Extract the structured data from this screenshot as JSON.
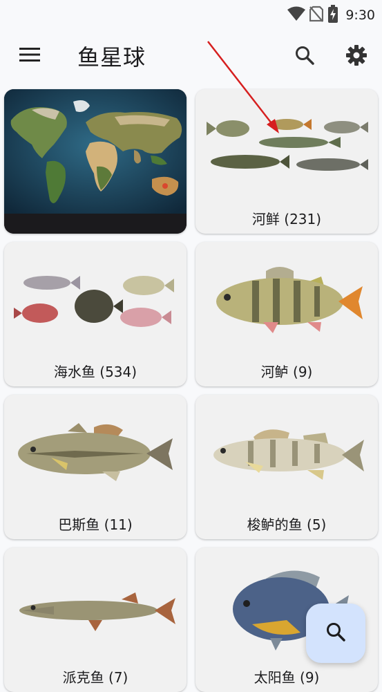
{
  "status_bar": {
    "time": "9:30"
  },
  "app_bar": {
    "title": "鱼星球"
  },
  "categories": [
    {
      "label": ""
    },
    {
      "label": "河鲜 (231)"
    },
    {
      "label": "海水鱼 (534)"
    },
    {
      "label": "河鲈 (9)"
    },
    {
      "label": "巴斯鱼 (11)"
    },
    {
      "label": "梭鲈的鱼 (5)"
    },
    {
      "label": "派克鱼 (7)"
    },
    {
      "label": "太阳鱼 (9)"
    }
  ],
  "colors": {
    "fab_background": "#d3e3fd",
    "card_background": "#f1f1f1",
    "annotation_arrow": "#d61f1f"
  }
}
